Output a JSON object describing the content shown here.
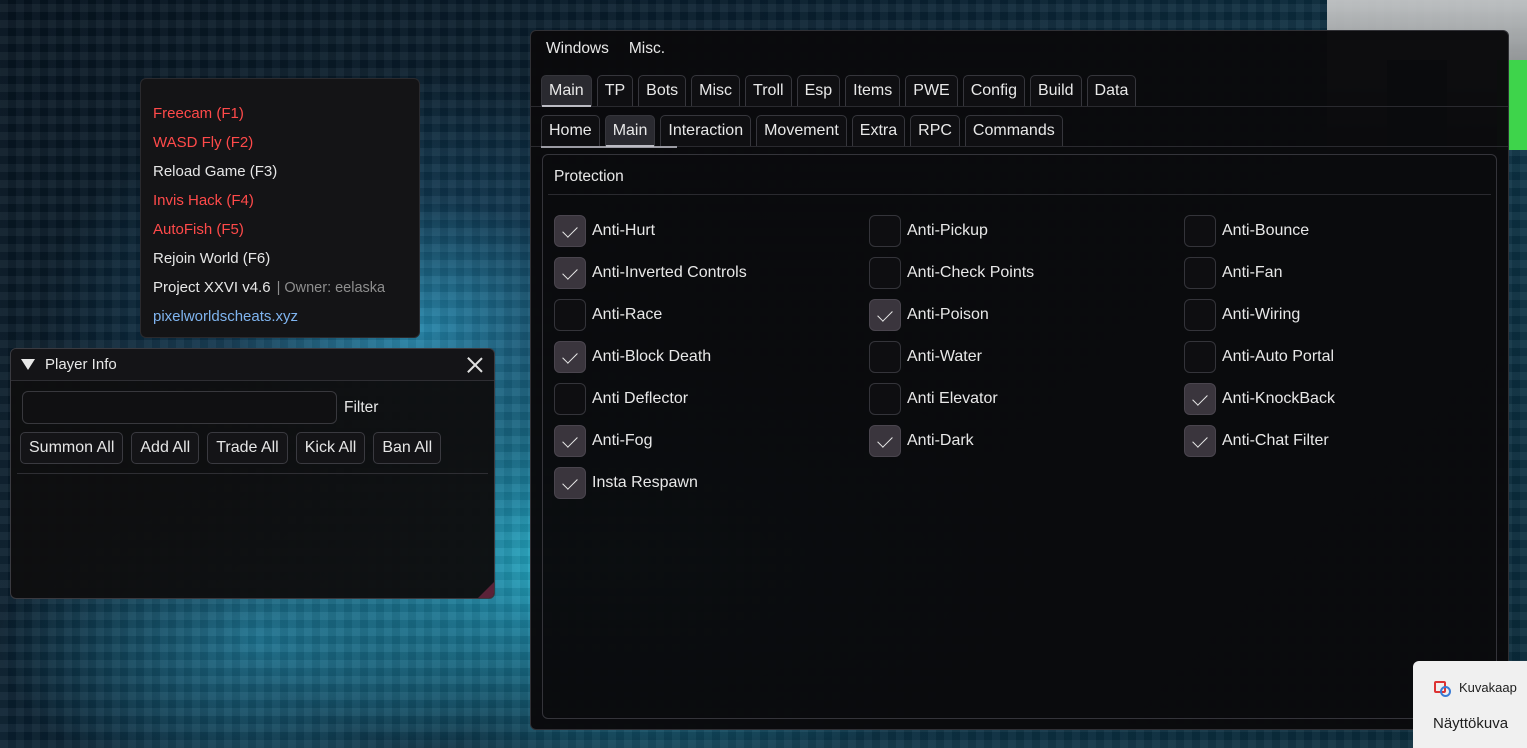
{
  "hotkeys": {
    "items": [
      {
        "label": "Freecam (F1)",
        "active": true
      },
      {
        "label": "WASD Fly (F2)",
        "active": true
      },
      {
        "label": "Reload Game (F3)",
        "active": false
      },
      {
        "label": "Invis Hack (F4)",
        "active": true
      },
      {
        "label": "AutoFish (F5)",
        "active": true
      },
      {
        "label": "Rejoin World (F6)",
        "active": false
      }
    ],
    "version": "Project XXVI v4.6",
    "owner": "| Owner: eelaska",
    "site": "pixelworldscheats.xyz",
    "colors": {
      "active": "#ff4a4a",
      "inactive": "#e6e6e6",
      "link": "#7fb4ef"
    }
  },
  "player_info": {
    "title": "Player Info",
    "filter_value": "",
    "filter_label": "Filter",
    "buttons": {
      "summon_all": "Summon All",
      "add_all": "Add All",
      "trade_all": "Trade All",
      "kick_all": "Kick All",
      "ban_all": "Ban All"
    }
  },
  "main_window": {
    "menu": {
      "windows": "Windows",
      "misc": "Misc."
    },
    "top_tabs": [
      "Main",
      "TP",
      "Bots",
      "Misc",
      "Troll",
      "Esp",
      "Items",
      "PWE",
      "Config",
      "Build",
      "Data"
    ],
    "top_tab_active": "Main",
    "sub_tabs": [
      "Home",
      "Main",
      "Interaction",
      "Movement",
      "Extra",
      "RPC",
      "Commands"
    ],
    "sub_tab_active": "Main",
    "section_title": "Protection",
    "options": [
      {
        "label": "Anti-Hurt",
        "checked": true
      },
      {
        "label": "Anti-Pickup",
        "checked": false
      },
      {
        "label": "Anti-Bounce",
        "checked": false
      },
      {
        "label": "Anti-Inverted Controls",
        "checked": true
      },
      {
        "label": "Anti-Check Points",
        "checked": false
      },
      {
        "label": "Anti-Fan",
        "checked": false
      },
      {
        "label": "Anti-Race",
        "checked": false
      },
      {
        "label": "Anti-Poison",
        "checked": true
      },
      {
        "label": "Anti-Wiring",
        "checked": false
      },
      {
        "label": "Anti-Block Death",
        "checked": true
      },
      {
        "label": "Anti-Water",
        "checked": false
      },
      {
        "label": "Anti-Auto Portal",
        "checked": false
      },
      {
        "label": "Anti Deflector",
        "checked": false
      },
      {
        "label": "Anti Elevator",
        "checked": false
      },
      {
        "label": "Anti-KnockBack",
        "checked": true
      },
      {
        "label": "Anti-Fog",
        "checked": true
      },
      {
        "label": "Anti-Dark",
        "checked": true
      },
      {
        "label": "Anti-Chat Filter",
        "checked": true
      },
      {
        "label": "Insta Respawn",
        "checked": true
      }
    ]
  },
  "notification": {
    "app": "Kuvakaap",
    "text": "Näyttökuva"
  }
}
